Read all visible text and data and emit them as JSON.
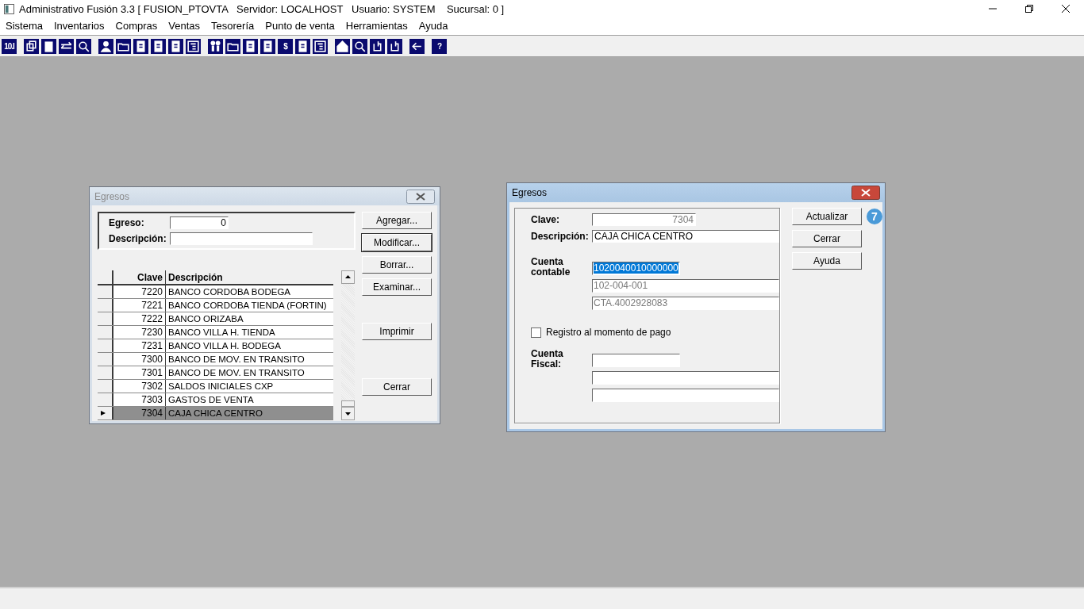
{
  "window": {
    "title": "Administrativo Fusión 3.3 [ FUSION_PTOVTA   Servidor: LOCALHOST   Usuario: SYSTEM    Sucursal: 0 ]"
  },
  "menu": [
    "Sistema",
    "Inventarios",
    "Compras",
    "Ventas",
    "Tesorería",
    "Punto de venta",
    "Herramientas",
    "Ayuda"
  ],
  "toolbar": [
    [
      {
        "kind": "glyph",
        "label": "10.I"
      }
    ],
    [
      {
        "kind": "icon"
      },
      {
        "kind": "icon"
      },
      {
        "kind": "icon"
      },
      {
        "kind": "icon"
      }
    ],
    [
      {
        "kind": "icon"
      },
      {
        "kind": "icon"
      },
      {
        "kind": "icon"
      },
      {
        "kind": "icon"
      },
      {
        "kind": "icon"
      },
      {
        "kind": "icon"
      }
    ],
    [
      {
        "kind": "icon"
      },
      {
        "kind": "icon"
      },
      {
        "kind": "icon"
      },
      {
        "kind": "icon"
      },
      {
        "kind": "glyph",
        "label": "$"
      },
      {
        "kind": "icon"
      },
      {
        "kind": "icon"
      }
    ],
    [
      {
        "kind": "icon"
      },
      {
        "kind": "icon"
      },
      {
        "kind": "icon"
      },
      {
        "kind": "icon"
      }
    ],
    [
      {
        "kind": "icon"
      }
    ],
    [
      {
        "kind": "glyph",
        "label": "?"
      }
    ]
  ],
  "list_window": {
    "title": "Egresos",
    "active": false,
    "filter": {
      "egreso_label": "Egreso:",
      "egreso_value": "0",
      "descripcion_label": "Descripción:"
    },
    "columns": [
      "Clave",
      "Descripción"
    ],
    "rows": [
      {
        "clave": "7220",
        "descripcion": "BANCO CORDOBA BODEGA",
        "selected": false
      },
      {
        "clave": "7221",
        "descripcion": "BANCO CORDOBA TIENDA (FORTIN)",
        "selected": false
      },
      {
        "clave": "7222",
        "descripcion": "BANCO ORIZABA",
        "selected": false
      },
      {
        "clave": "7230",
        "descripcion": "BANCO VILLA H. TIENDA",
        "selected": false
      },
      {
        "clave": "7231",
        "descripcion": "BANCO VILLA H. BODEGA",
        "selected": false
      },
      {
        "clave": "7300",
        "descripcion": "BANCO DE MOV. EN TRANSITO",
        "selected": false
      },
      {
        "clave": "7301",
        "descripcion": "BANCO DE MOV. EN TRANSITO",
        "selected": false
      },
      {
        "clave": "7302",
        "descripcion": "SALDOS INICIALES CXP",
        "selected": false
      },
      {
        "clave": "7303",
        "descripcion": "GASTOS DE VENTA",
        "selected": false
      },
      {
        "clave": "7304",
        "descripcion": "CAJA CHICA CENTRO",
        "selected": true
      }
    ],
    "button_groups": [
      [
        "Agregar...",
        "Modificar...",
        "Borrar...",
        "Examinar..."
      ],
      [
        "Imprimir"
      ],
      [
        "Cerrar"
      ]
    ]
  },
  "edit_window": {
    "title": "Egresos",
    "active": true,
    "clave_label": "Clave:",
    "clave_value": "7304",
    "descripcion_label": "Descripción:",
    "descripcion_value": "CAJA CHICA CENTRO",
    "cuenta_contable_label": "Cuenta contable",
    "cuenta_contable": [
      {
        "value": "1020040010000000",
        "disabled": false,
        "highlighted": true
      },
      {
        "value": "102-004-001",
        "disabled": true,
        "highlighted": false
      },
      {
        "value": "CTA.4002928083",
        "disabled": true,
        "highlighted": false
      }
    ],
    "registro_label": "Registro al momento de pago",
    "registro_checked": false,
    "cuenta_fiscal_label": "Cuenta Fiscal:",
    "buttons": [
      "Actualizar",
      "Cerrar",
      "Ayuda"
    ],
    "badge": "7"
  }
}
